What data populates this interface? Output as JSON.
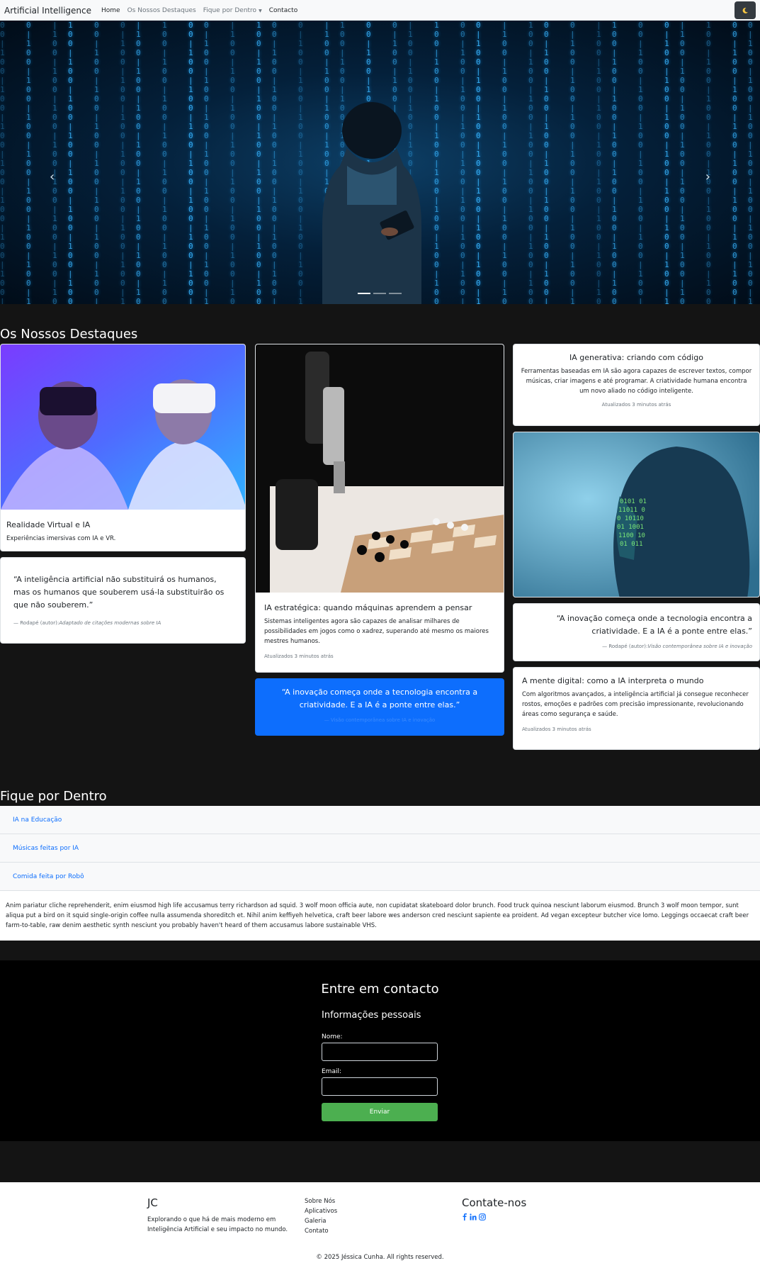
{
  "navbar": {
    "brand": "Artificial Intelligence",
    "links": [
      "Home",
      "Os Nossos Destaques",
      "Fique por Dentro",
      "Contacto"
    ],
    "theme_icon": "moon-icon"
  },
  "hero": {
    "prev_icon": "chevron-left-icon",
    "next_icon": "chevron-right-icon",
    "indicator_count": 3,
    "active_indicator": 1
  },
  "destaques": {
    "title": "Os Nossos Destaques",
    "vr_card": {
      "title": "Realidade Virtual e IA",
      "text": "Experiências imersivas com IA e VR."
    },
    "quote1": {
      "text": "“A inteligência artificial não substituirá os humanos, mas os humanos que souberem usá-la substituirão os que não souberem.”",
      "footer_label": "Rodapé (autor):",
      "footer_source": "Adaptado de citações modernas sobre IA"
    },
    "chess_card": {
      "title": "IA estratégica: quando máquinas aprendem a pensar",
      "text": "Sistemas inteligentes agora são capazes de analisar milhares de possibilidades em jogos como o xadrez, superando até mesmo os maiores mestres humanos.",
      "meta": "Atualizados 3 minutos atrás"
    },
    "blue_quote": {
      "text": "“A inovação começa onde a tecnologia encontra a criatividade. E a IA é a ponte entre elas.”",
      "footer": "Visão contemporânea sobre IA e inovação"
    },
    "gen_card": {
      "title": "IA generativa: criando com código",
      "text": "Ferramentas baseadas em IA são agora capazes de escrever textos, compor músicas, criar imagens e até programar. A criatividade humana encontra um novo aliado no código inteligente.",
      "meta": "Atualizados 3 minutos atrás"
    },
    "quote2": {
      "text": "“A inovação começa onde a tecnologia encontra a criatividade. E a IA é a ponte entre elas.”",
      "footer_label": "Rodapé (autor):",
      "footer_source": "Visão contemporânea sobre IA e inovação"
    },
    "mind_card": {
      "title": "A mente digital: como a IA interpreta o mundo",
      "text": "Com algoritmos avançados, a inteligência artificial já consegue reconhecer rostos, emoções e padrões com precisão impressionante, revolucionando áreas como segurança e saúde.",
      "meta": "Atualizados 3 minutos atrás"
    }
  },
  "fique": {
    "title": "Fique por Dentro",
    "items": [
      "IA na Educação",
      "Músicas feitas por IA",
      "Comida feita por Robô"
    ],
    "body": "Anim pariatur cliche reprehenderit, enim eiusmod high life accusamus terry richardson ad squid. 3 wolf moon officia aute, non cupidatat skateboard dolor brunch. Food truck quinoa nesciunt laborum eiusmod. Brunch 3 wolf moon tempor, sunt aliqua put a bird on it squid single-origin coffee nulla assumenda shoreditch et. Nihil anim keffiyeh helvetica, craft beer labore wes anderson cred nesciunt sapiente ea proident. Ad vegan excepteur butcher vice lomo. Leggings occaecat craft beer farm-to-table, raw denim aesthetic synth nesciunt you probably haven't heard of them accusamus labore sustainable VHS."
  },
  "contact": {
    "title": "Entre em contacto",
    "subtitle": "Informações pessoais",
    "name_label": "Nome:",
    "email_label": "Email:",
    "submit": "Enviar"
  },
  "footer": {
    "brand": "JC",
    "description": "Explorando o que há de mais moderno em Inteligência Artificial e seu impacto no mundo.",
    "links": [
      "Sobre Nós",
      "Aplicativos",
      "Galeria",
      "Contato"
    ],
    "contact_title": "Contate-nos",
    "social_icons": [
      "facebook-icon",
      "linkedin-icon",
      "instagram-icon"
    ],
    "copyright": "© 2025 Jéssica Cunha. All rights reserved."
  },
  "colors": {
    "accent_blue": "#0d6efd",
    "submit_green": "#4caf50",
    "dark_bg": "#141414"
  }
}
